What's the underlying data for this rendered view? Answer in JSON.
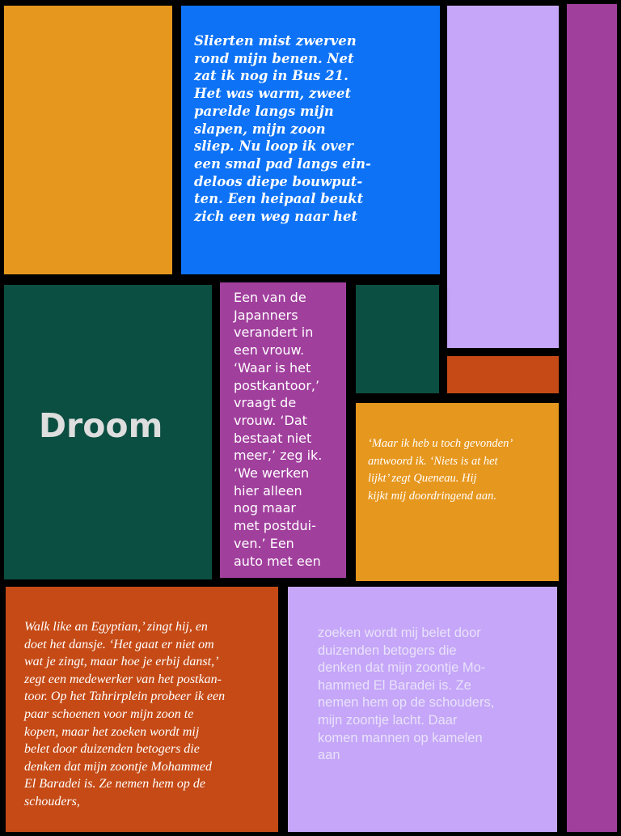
{
  "colors": {
    "background": "#000000",
    "orange": "#e6971d",
    "blue": "#0d72f5",
    "lavender": "#c5a6f8",
    "purple": "#a13f9d",
    "dark_green": "#0b4f42",
    "rust": "#c54a15"
  },
  "blocks": {
    "blue_text": "Slierten mist zwerven\nrond mijn benen. Net\nzat ik nog in Bus 21.\nHet was warm, zweet\nparelde langs mijn\nslapen, mijn zoon\nsliep. Nu loop ik over\neen smal pad langs ein-\ndeloos diepe bouwput-\nten. Een heipaal beukt\nzich een weg naar het",
    "title": "Droom",
    "purple_text": "Een van de\nJapanners\nverandert in\neen vrouw.\n‘Waar is het\npostkantoor,’\nvraagt de\nvrouw. ‘Dat\nbestaat niet\nmeer,’ zeg ik.\n‘We werken\nhier alleen\nnog maar\nmet postdui-\nven.’ Een\nauto met een",
    "orange_text": "‘Maar ik heb u toch gevonden’\nantwoord ik. ‘Niets is at het\nlijkt’ zegt Queneau. Hij\nkijkt mij doordringend aan.",
    "red_text": "Walk like an Egyptian,’ zingt hij, en\ndoet het dansje. ‘Het gaat er niet om\nwat je zingt, maar hoe je erbij danst,’\nzegt een medewerker van het postkan-\ntoor. Op het Tahrirplein probeer ik een\npaar schoenen voor mijn zoon te\nkopen, maar het zoeken wordt mij\nbelet door duizenden betogers die\ndenken dat mijn zoontje Mohammed\nEl Baradei is. Ze nemen hem op de\nschouders,",
    "lavender_text": "zoeken wordt mij belet door\nduizenden betogers die\ndenken dat mijn zoontje Mo-\nhammed El Baradei is. Ze\nnemen hem op de schouders,\nmijn zoontje lacht. Daar\nkomen mannen op kamelen\naan"
  }
}
